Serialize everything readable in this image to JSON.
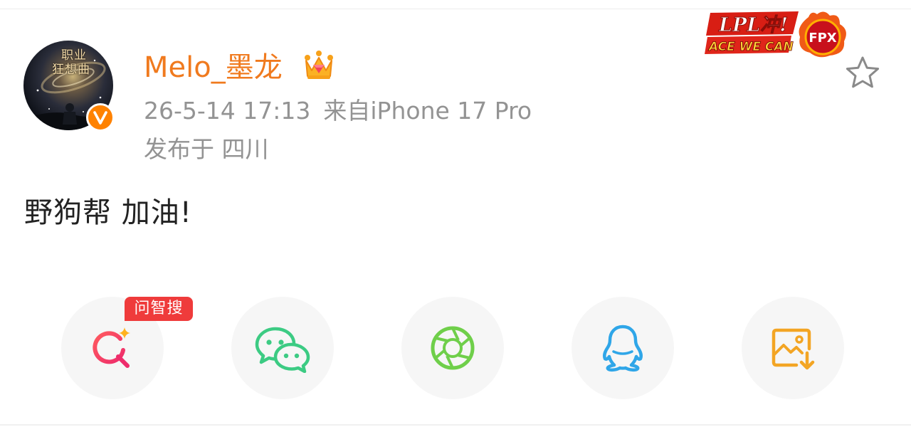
{
  "post": {
    "author": {
      "name": "Melo_墨龙",
      "avatar_text": [
        "职业",
        "狂想曲"
      ],
      "verified_badge": "V",
      "verified_color": "#ff8200",
      "name_color": "#f07a1e",
      "member_icon": "crown-icon"
    },
    "time": "26-5-14 17:13",
    "source": "来自iPhone 17 Pro",
    "location": "发布于 四川",
    "text": "野狗帮 加油!",
    "team_badge": {
      "line1": "LPL冲!",
      "line2": "ACE WE CAN",
      "team": "FPX"
    },
    "favorite_icon": "star-outline-icon"
  },
  "share_bar": {
    "buttons": [
      {
        "name": "search-ai",
        "icon": "ai-search-icon",
        "tag": "问智搜",
        "tag_color": "#ef3b3b",
        "color": "#f2485e"
      },
      {
        "name": "wechat",
        "icon": "wechat-icon",
        "color": "#3ccb83"
      },
      {
        "name": "moments",
        "icon": "aperture-icon",
        "color": "#6fcf4a"
      },
      {
        "name": "qq",
        "icon": "qq-icon",
        "color": "#2fa6e8"
      },
      {
        "name": "save-image",
        "icon": "image-download-icon",
        "color": "#f3a524"
      }
    ]
  }
}
